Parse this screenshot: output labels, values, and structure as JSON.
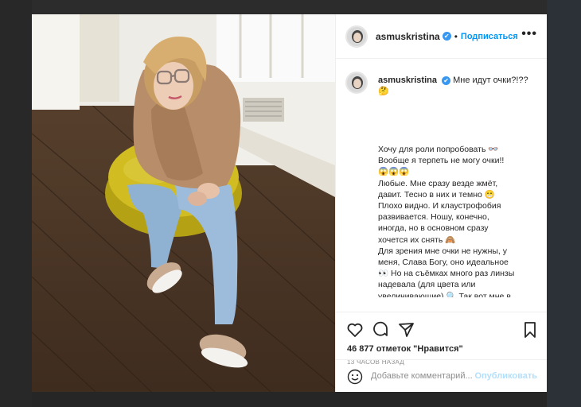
{
  "post": {
    "username": "asmuskristina",
    "verified_mark": "✔",
    "separator": "•",
    "follow_label": "Подписаться",
    "more_label": "•••",
    "caption_title": "Мне идут очки?!??",
    "caption_emoji": "🤔",
    "caption_body": "Хочу для роли попробовать 👓\nВообще я терпеть не могу очки!!\n😱😱😱\nЛюбые. Мне сразу везде жмёт,\nдавит. Тесно в них и темно 😁\nПлохо видно. И клаустрофобия\nразвивается. Ношу, конечно,\nиногда, но в основном сразу\nхочется их снять 🙈\nДля зрения мне очки не нужны, у\nменя, Слава Богу, оно идеальное\n👀 Но на съёмках много раз линзы\nнадевала (для цвета или\nувеличивающие) 🔍 Так вот мне в\nних даже удобней))))",
    "likes_count": "46 877",
    "likes_text": "отметок \"Нравится\"",
    "time_ago": "13 ЧАСОВ НАЗАД",
    "comment_placeholder": "Добавьте комментарий...",
    "publish_label": "Опубликовать"
  },
  "icons": [
    "heart-icon",
    "comment-icon",
    "share-icon",
    "bookmark-icon",
    "smile-icon"
  ],
  "colors": {
    "accent": "#0095f6",
    "publish_disabled": "#b2dffc",
    "text": "#262626",
    "muted": "#8e8e8e",
    "verified": "#3897f0"
  }
}
